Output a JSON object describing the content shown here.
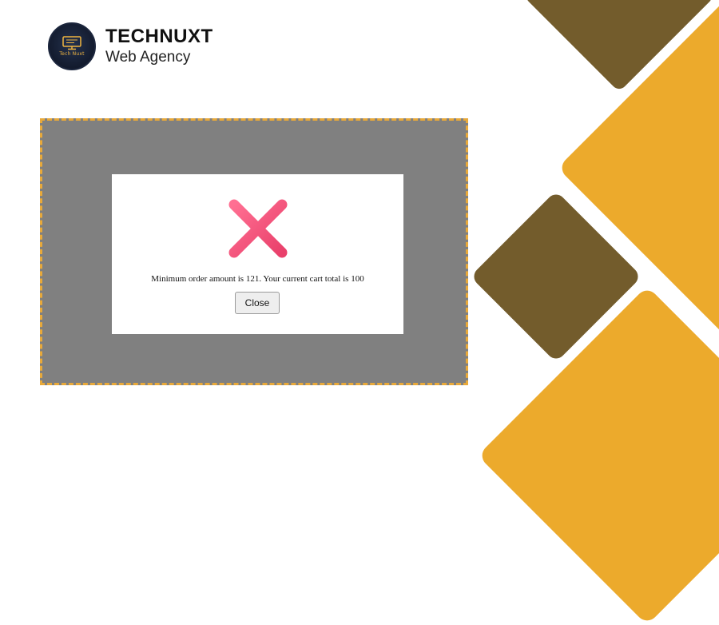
{
  "brand": {
    "name": "TECHNUXT",
    "subtitle": "Web Agency",
    "logo_mini_text": "Tech Nuxt"
  },
  "dialog": {
    "icon": "close-x-icon",
    "message": "Minimum order amount is 121. Your current cart total is 100",
    "close_label": "Close"
  },
  "colors": {
    "gold": "#ecaa2c",
    "brown": "#735c2c",
    "frame_border": "#e8a93a",
    "overlay": "#808080",
    "x_icon": "#f4577e"
  }
}
